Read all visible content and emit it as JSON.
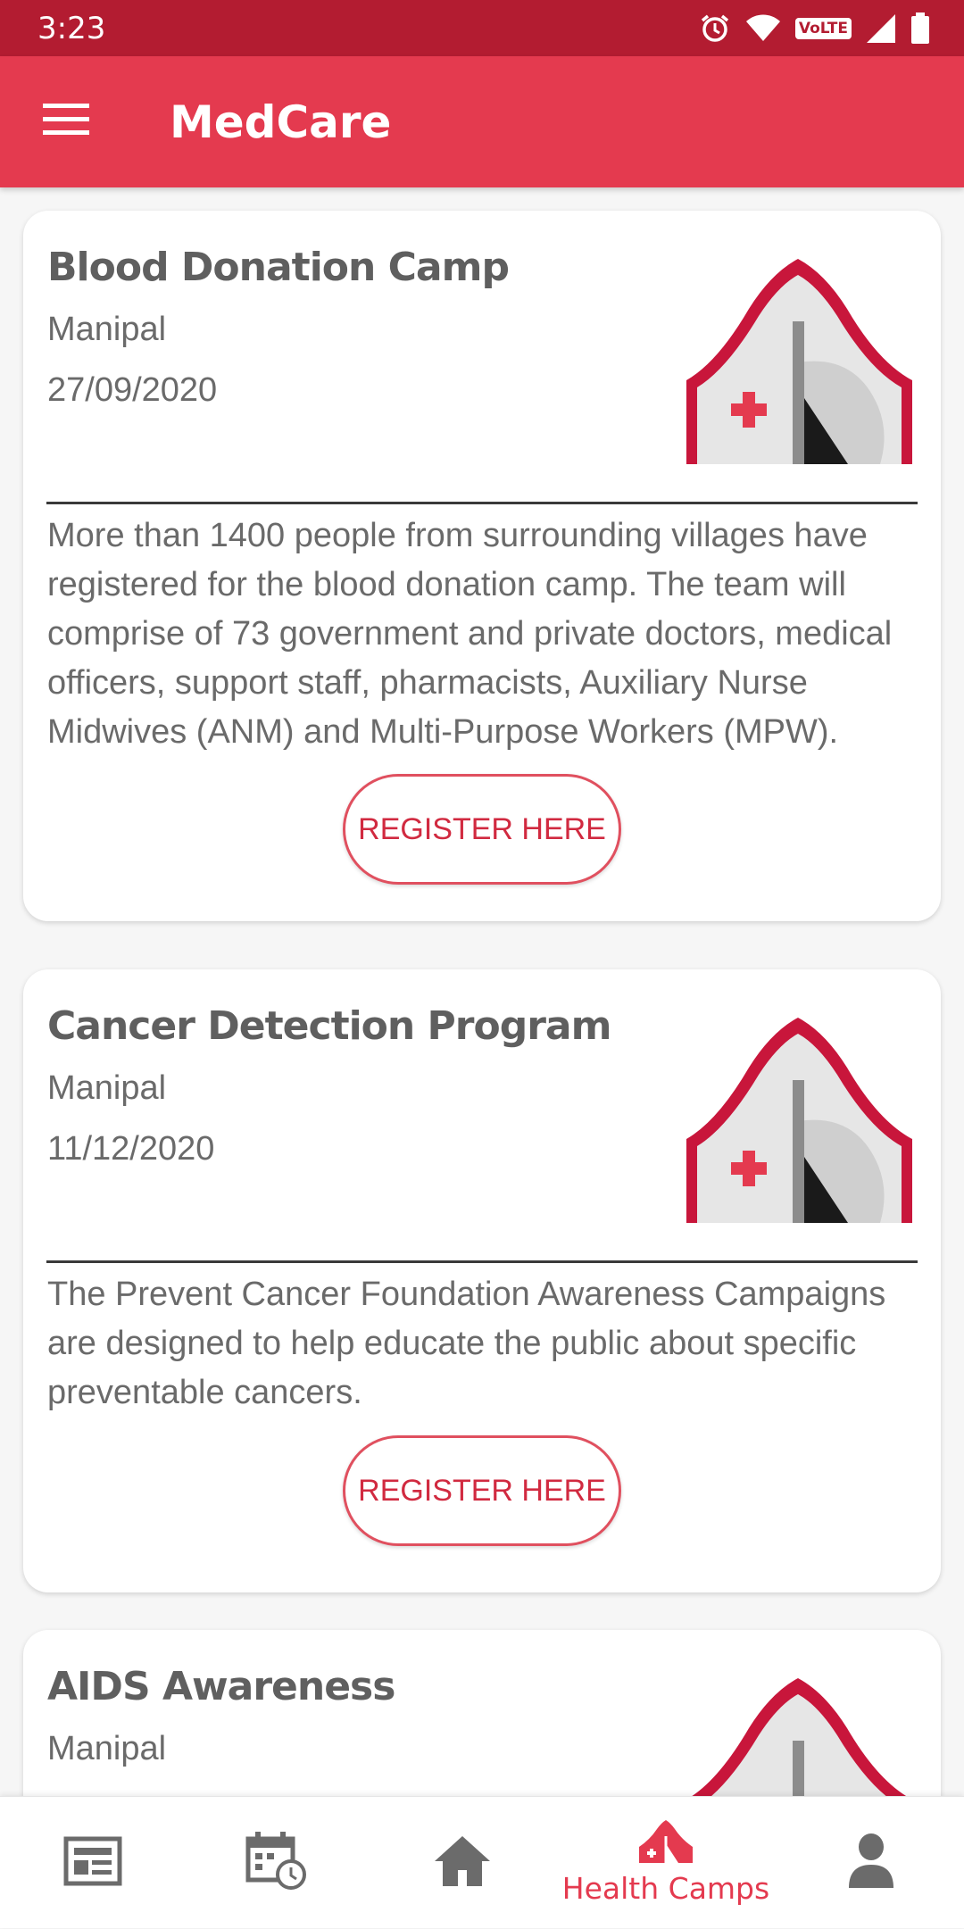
{
  "status_bar": {
    "time": "3:23",
    "icons": [
      "alarm-icon",
      "wifi-icon",
      "volte-icon",
      "signal-icon",
      "battery-icon"
    ],
    "volte_text": "VoLTE"
  },
  "app_bar": {
    "title": "MedCare",
    "menu_icon": "hamburger-menu-icon"
  },
  "colors": {
    "accent": "#e43a4f",
    "status_bar": "#b31c31",
    "text": "#6a6a6a"
  },
  "cards": [
    {
      "title": "Blood Donation Camp",
      "location": "Manipal",
      "date": "27/09/2020",
      "description": "More than 1400 people from surrounding villages have registered for the blood donation camp. The team will comprise of 73 government and private doctors, medical officers, support staff, pharmacists, Auxiliary Nurse Midwives (ANM) and Multi-Purpose Workers (MPW).",
      "button": "REGISTER HERE",
      "image_icon": "medical-tent-icon"
    },
    {
      "title": "Cancer Detection Program",
      "location": "Manipal",
      "date": "11/12/2020",
      "description": "The Prevent Cancer Foundation Awareness Campaigns are designed to help educate the public about specific preventable cancers.",
      "button": "REGISTER HERE",
      "image_icon": "medical-tent-icon"
    },
    {
      "title": "AIDS Awareness",
      "location": "Manipal",
      "image_icon": "medical-tent-icon"
    }
  ],
  "bottom_nav": {
    "items": [
      {
        "icon": "news-icon",
        "label": ""
      },
      {
        "icon": "calendar-clock-icon",
        "label": ""
      },
      {
        "icon": "home-icon",
        "label": ""
      },
      {
        "icon": "health-camps-tent-icon",
        "label": "Health Camps",
        "active": true
      },
      {
        "icon": "profile-icon",
        "label": ""
      }
    ]
  }
}
